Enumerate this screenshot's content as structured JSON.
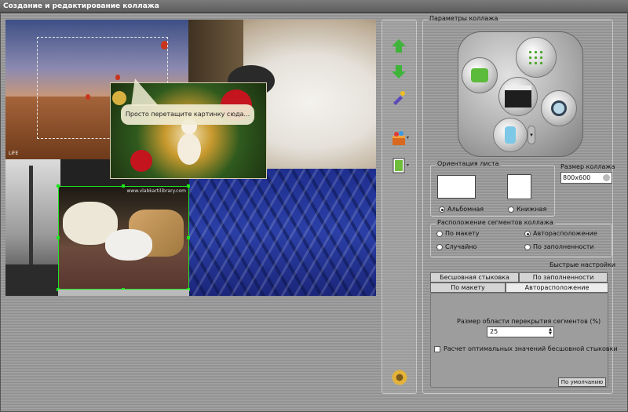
{
  "window": {
    "title": "Создание и редактирование коллажа"
  },
  "canvas": {
    "hint": "Просто перетащите картинку сюда...",
    "watermark": "www.vlabkartilibrary.com",
    "small_logo": "LiFE"
  },
  "toolbar": {
    "icons": [
      "arrow-up-icon",
      "arrow-down-icon",
      "brush-icon",
      "box-icon",
      "page-icon",
      "gear-icon"
    ],
    "dropdown": "▾"
  },
  "params": {
    "title": "Параметры коллажа",
    "hub_icons": [
      "frames-icon",
      "dots-icon",
      "clapper-icon",
      "magnifier-icon",
      "bottle-icon"
    ]
  },
  "orientation": {
    "title": "Ориентация листа",
    "landscape": "Альбомная",
    "portrait": "Книжная",
    "selected": "landscape"
  },
  "size": {
    "label": "Размер коллажа",
    "value": "800x600"
  },
  "placement": {
    "title": "Расположение сегментов коллажа",
    "options": [
      "По макету",
      "Авторасположение",
      "Случайно",
      "По заполненности"
    ],
    "selected": "Авторасположение"
  },
  "quick": {
    "label": "Быстрые настройки",
    "tabs_row1": [
      "Бесшовная стыковка",
      "По заполненности"
    ],
    "tabs_row2": [
      "По макету",
      "Авторасположение"
    ],
    "active_tab": "Авторасположение",
    "overlap_label": "Размер области перекрытия сегментов (%)",
    "overlap_value": "25",
    "calc_label": "Расчет оптимальных значений  бесшовной стыковки",
    "calc_checked": false,
    "default_button": "По умолчанию"
  },
  "colors": {
    "accent_green": "#3fb43a",
    "selection": "#1ee51e"
  }
}
